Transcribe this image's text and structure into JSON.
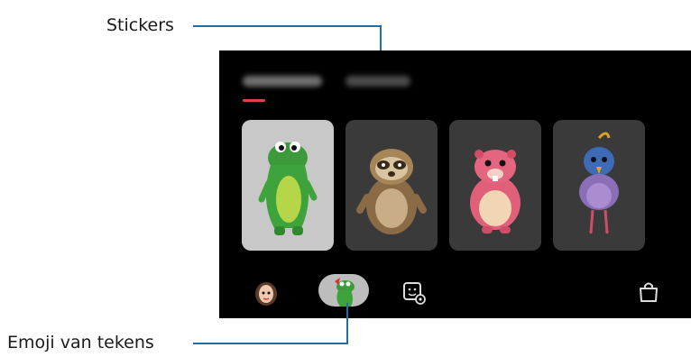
{
  "callouts": {
    "stickers": "Stickers",
    "emoji_van_tekens": "Emoji van tekens"
  },
  "tabs": [
    {
      "label": "AR emoji",
      "selected": true
    },
    {
      "label": "Stickers",
      "selected": false
    }
  ],
  "characters": [
    {
      "name": "green-dinosaur",
      "selected": true
    },
    {
      "name": "sloth",
      "selected": false
    },
    {
      "name": "pink-hamster",
      "selected": false
    },
    {
      "name": "blue-bird",
      "selected": false
    }
  ],
  "bottom_bar": {
    "items": [
      "my-emoji-avatar",
      "character-emoji",
      "sticker-settings",
      "store"
    ]
  },
  "colors": {
    "callout_line": "#1e6fa8",
    "tab_indicator": "#e0404a",
    "selected_card": "#c8c8c8",
    "card": "#3a3a3a"
  }
}
